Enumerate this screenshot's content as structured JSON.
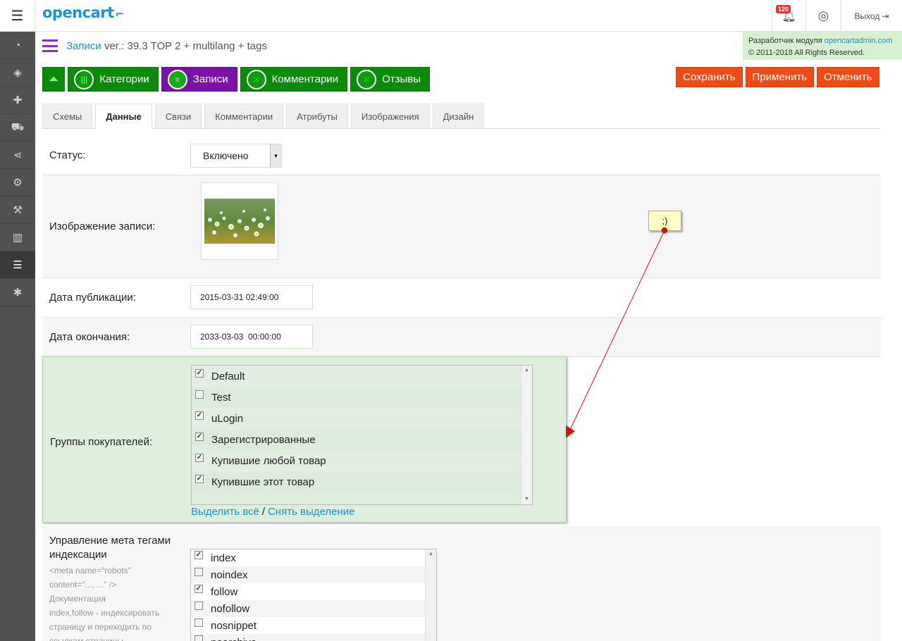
{
  "header": {
    "logo": "opencart",
    "notifications_count": "120",
    "logout_label": "Выход"
  },
  "sidebar": {
    "items": [
      {
        "icon": "dashboard-icon",
        "glyph": "◔",
        "active": false
      },
      {
        "icon": "tags-icon",
        "glyph": "◈",
        "active": false
      },
      {
        "icon": "puzzle-icon",
        "glyph": "✚",
        "active": false
      },
      {
        "icon": "cart-icon",
        "glyph": "⛟",
        "active": false
      },
      {
        "icon": "share-icon",
        "glyph": "⋖",
        "active": false
      },
      {
        "icon": "gear-icon",
        "glyph": "⚙",
        "active": false
      },
      {
        "icon": "wrench-icon",
        "glyph": "⚒",
        "active": false
      },
      {
        "icon": "bar-chart-icon",
        "glyph": "▥",
        "active": false
      },
      {
        "icon": "list-icon",
        "glyph": "☰",
        "active": true
      },
      {
        "icon": "asterisk-icon",
        "glyph": "✱",
        "active": false
      }
    ]
  },
  "dev_notice": {
    "prefix": "Разработчик модуля",
    "link": "opencartadmin.com",
    "copyright": "© 2011-2018 All Rights Reserved."
  },
  "page": {
    "title": "Записи",
    "version": "ver.: 39.3 TOP 2 + multilang + tags"
  },
  "module_buttons": [
    {
      "label": "Категории",
      "color": "#0c8a0c"
    },
    {
      "label": "Записи",
      "color": "#7b12a8"
    },
    {
      "label": "Комментарии",
      "color": "#0c8a0c"
    },
    {
      "label": "Отзывы",
      "color": "#0c8a0c"
    }
  ],
  "actions": {
    "save": "Сохранить",
    "apply": "Применить",
    "cancel": "Отменить"
  },
  "tabs": [
    {
      "label": "Схемы",
      "active": false
    },
    {
      "label": "Данные",
      "active": true
    },
    {
      "label": "Связи",
      "active": false
    },
    {
      "label": "Комментарии",
      "active": false
    },
    {
      "label": "Атрибуты",
      "active": false
    },
    {
      "label": "Изображения",
      "active": false
    },
    {
      "label": "Дизайн",
      "active": false
    }
  ],
  "form": {
    "status_label": "Статус:",
    "status_value": "Включено",
    "image_label": "Изображение записи:",
    "pub_date_label": "Дата публикации:",
    "pub_date_value": "2015-03-31 02:49:00",
    "end_date_label": "Дата окончания:",
    "end_date_value": "2033-03-03  00:00:00",
    "groups_label": "Группы покупателей:",
    "groups": [
      {
        "label": "Default",
        "checked": true
      },
      {
        "label": "Test",
        "checked": false
      },
      {
        "label": "uLogin",
        "checked": true
      },
      {
        "label": "Зарегистрированные",
        "checked": true
      },
      {
        "label": "Купившие любой товар",
        "checked": true
      },
      {
        "label": "Купившие этот товар",
        "checked": true
      }
    ],
    "select_all": "Выделить всё",
    "separator": "/",
    "deselect": "Снять выделение",
    "meta_label": "Управление мета тегами индексации",
    "meta_help": [
      "<meta name=\"robots\"",
      "content=\"..., ...\" />",
      "Документация",
      "index,follow - индексировать",
      "страницу и переходить по",
      "ссылкам страницы"
    ],
    "meta_options": [
      {
        "label": "index",
        "checked": true
      },
      {
        "label": "noindex",
        "checked": false
      },
      {
        "label": "follow",
        "checked": true
      },
      {
        "label": "nofollow",
        "checked": false
      },
      {
        "label": "nosnippet",
        "checked": false
      },
      {
        "label": "noarchive",
        "checked": false
      }
    ]
  },
  "annotation": {
    "note_text": ";)"
  }
}
